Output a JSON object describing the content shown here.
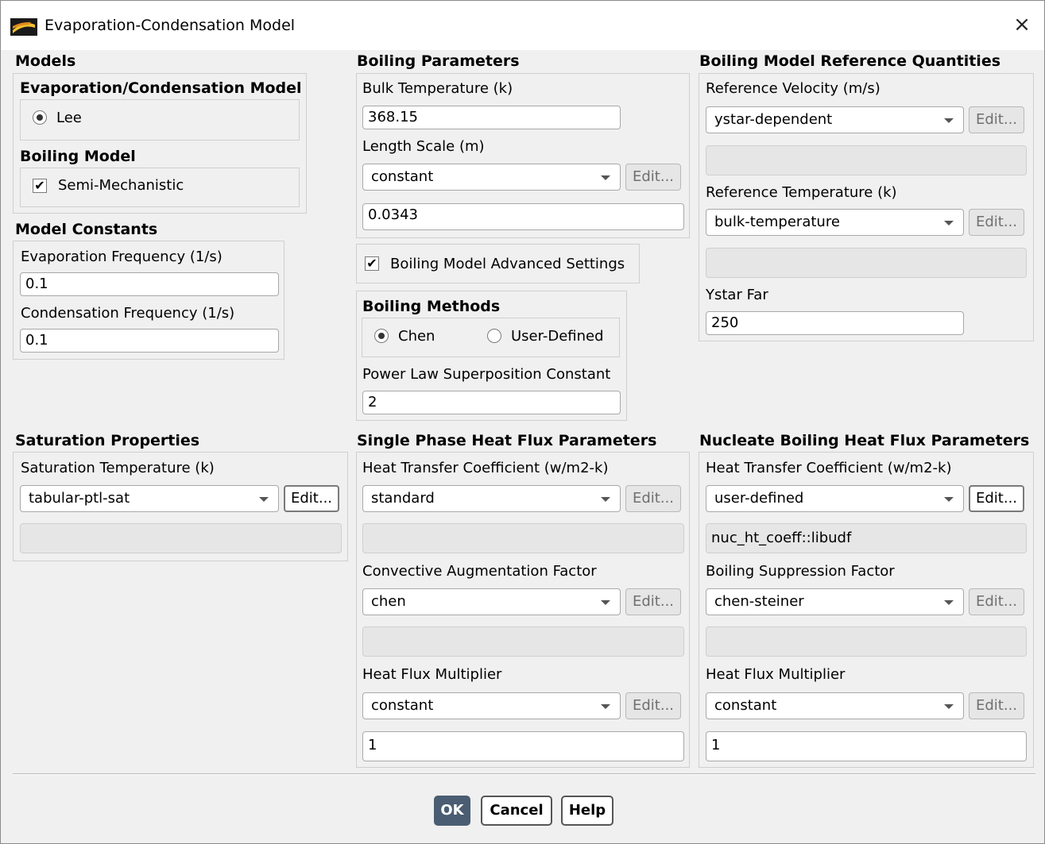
{
  "window": {
    "title": "Evaporation-Condensation Model",
    "close": "×"
  },
  "models": {
    "title": "Models",
    "evap": {
      "title": "Evaporation/Condensation Model",
      "option": "Lee",
      "selected": true
    },
    "boiling": {
      "title": "Boiling Model",
      "option": "Semi-Mechanistic",
      "checked": true
    }
  },
  "constants": {
    "title": "Model Constants",
    "evap_label": "Evaporation Frequency (1/s)",
    "evap_value": "0.1",
    "cond_label": "Condensation Frequency (1/s)",
    "cond_value": "0.1"
  },
  "boiling_params": {
    "title": "Boiling Parameters",
    "bulk_label": "Bulk Temperature (k)",
    "bulk_value": "368.15",
    "length_label": "Length Scale (m)",
    "length_method": "constant",
    "length_value": "0.0343",
    "advanced_label": "Boiling Model Advanced Settings",
    "advanced_checked": true
  },
  "boiling_methods": {
    "title": "Boiling Methods",
    "options": [
      "Chen",
      "User-Defined"
    ],
    "selected": "Chen",
    "power_label": "Power Law Superposition Constant",
    "power_value": "2"
  },
  "reference": {
    "title": "Boiling Model Reference Quantities",
    "vel_label": "Reference Velocity (m/s)",
    "vel_method": "ystar-dependent",
    "vel_value": "",
    "temp_label": "Reference Temperature (k)",
    "temp_method": "bulk-temperature",
    "temp_value": "",
    "ystar_label": "Ystar Far",
    "ystar_value": "250"
  },
  "saturation": {
    "title": "Saturation Properties",
    "label": "Saturation Temperature (k)",
    "method": "tabular-ptl-sat",
    "value": ""
  },
  "single_phase": {
    "title": "Single Phase Heat Flux Parameters",
    "htc_label": "Heat Transfer Coefficient (w/m2-k)",
    "htc_method": "standard",
    "htc_value": "",
    "caf_label": "Convective Augmentation Factor",
    "caf_method": "chen",
    "caf_value": "",
    "hfm_label": "Heat Flux Multiplier",
    "hfm_method": "constant",
    "hfm_value": "1"
  },
  "nucleate": {
    "title": "Nucleate Boiling Heat Flux Parameters",
    "htc_label": "Heat Transfer Coefficient (w/m2-k)",
    "htc_method": "user-defined",
    "htc_value": "nuc_ht_coeff::libudf",
    "bsf_label": "Boiling Suppression Factor",
    "bsf_method": "chen-steiner",
    "bsf_value": "",
    "hfm_label": "Heat Flux Multiplier",
    "hfm_method": "constant",
    "hfm_value": "1"
  },
  "common": {
    "edit_label": "Edit..."
  },
  "buttons": {
    "ok": "OK",
    "cancel": "Cancel",
    "help": "Help"
  },
  "colors": {
    "primary_button": "#4a5d72",
    "disabled_field": "#e6e6e6"
  }
}
